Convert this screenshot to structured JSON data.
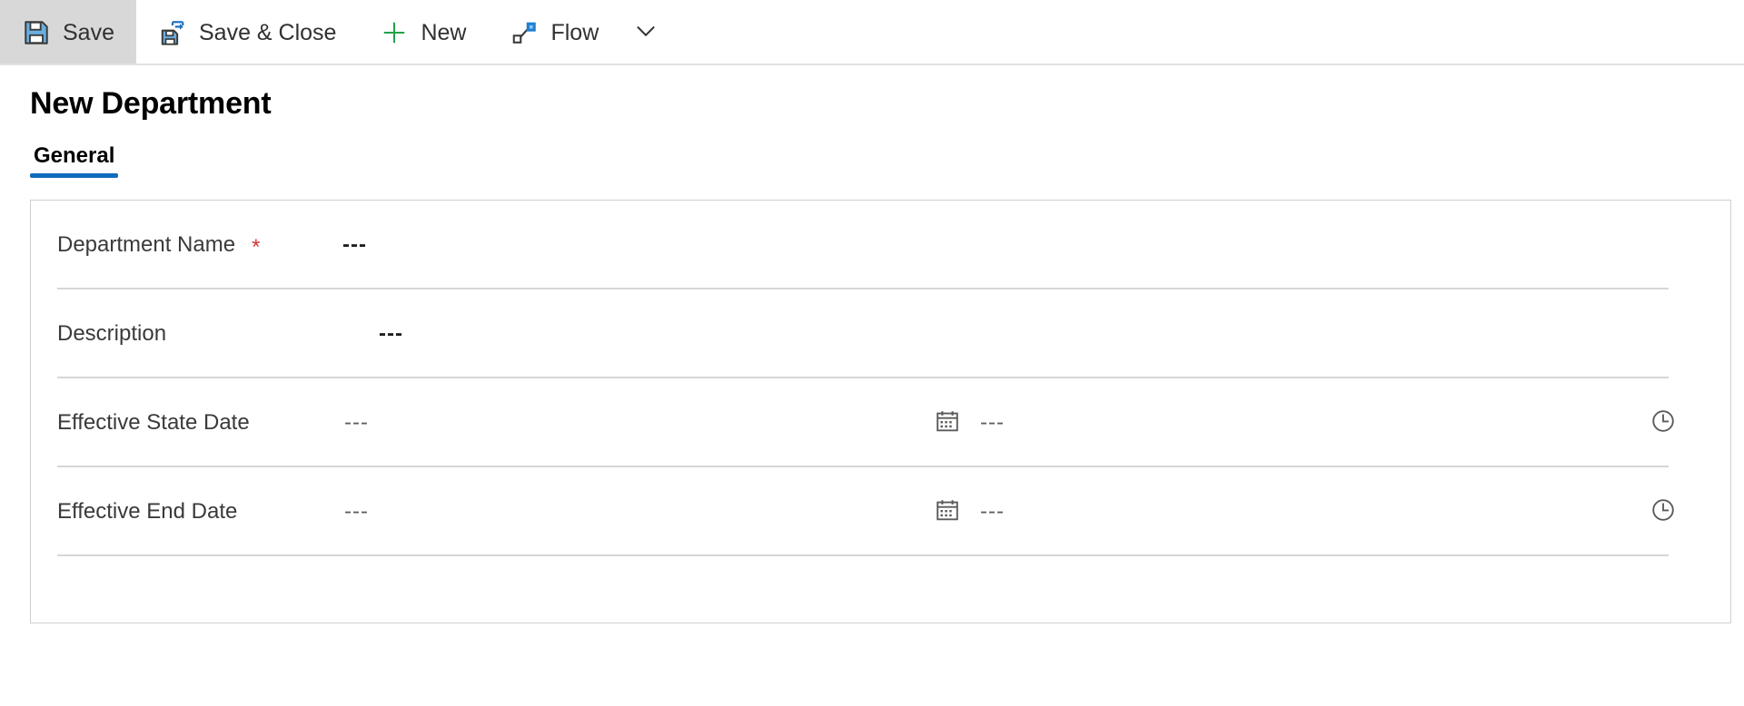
{
  "commandbar": {
    "buttons": [
      {
        "id": "save",
        "label": "Save",
        "icon": "save-icon",
        "active": true
      },
      {
        "id": "save-close",
        "label": "Save & Close",
        "icon": "save-close-icon",
        "active": false
      },
      {
        "id": "new",
        "label": "New",
        "icon": "plus-icon",
        "active": false
      },
      {
        "id": "flow",
        "label": "Flow",
        "icon": "flow-icon",
        "active": false
      }
    ],
    "overflow_icon": "chevron-down-icon"
  },
  "header": {
    "title": "New Department"
  },
  "tabs": [
    {
      "id": "general",
      "label": "General",
      "selected": true
    }
  ],
  "form": {
    "rows": [
      {
        "id": "department-name",
        "label": "Department Name",
        "required": true,
        "required_marker": "*",
        "value": "---"
      },
      {
        "id": "description",
        "label": "Description",
        "required": false,
        "value": "---"
      },
      {
        "id": "effective-state-date",
        "label": "Effective State Date",
        "required": false,
        "value": "---",
        "date_icon": "calendar-icon",
        "time_value": "---",
        "time_icon": "clock-icon"
      },
      {
        "id": "effective-end-date",
        "label": "Effective End Date",
        "required": false,
        "value": "---",
        "date_icon": "calendar-icon",
        "time_value": "---",
        "time_icon": "clock-icon"
      }
    ]
  },
  "colors": {
    "accent": "#0f6cbd",
    "required": "#d13438",
    "icon_blue": "#4f9fe0",
    "icon_dark": "#3a3a38",
    "new_green": "#22a14a",
    "divider": "#d6d6d6",
    "card_border": "#cfcfcf",
    "active_button_bg": "#d8d8d8"
  }
}
